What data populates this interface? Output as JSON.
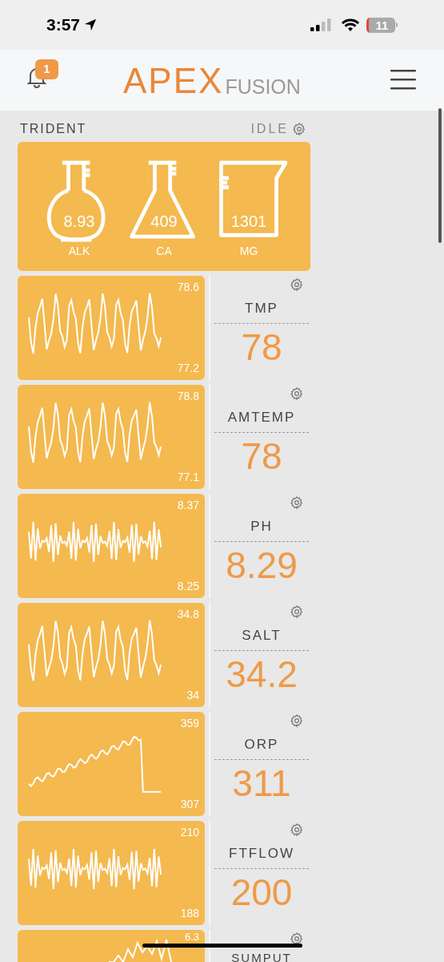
{
  "status_bar": {
    "time": "3:57",
    "battery": "11"
  },
  "header": {
    "notification_count": "1",
    "logo_main": "APEX",
    "logo_sub": "FUSION"
  },
  "trident": {
    "title": "TRIDENT",
    "status": "IDLE",
    "readings": [
      {
        "kind": "round_flask",
        "value": "8.93",
        "label": "ALK"
      },
      {
        "kind": "conical_flask",
        "value": "409",
        "label": "CA"
      },
      {
        "kind": "beaker",
        "value": "1301",
        "label": "MG"
      }
    ]
  },
  "probes": [
    {
      "name": "TMP",
      "value": "78",
      "max": "78.6",
      "min": "77.2"
    },
    {
      "name": "AMTEMP",
      "value": "78",
      "max": "78.8",
      "min": "77.1"
    },
    {
      "name": "PH",
      "value": "8.29",
      "max": "8.37",
      "min": "8.25"
    },
    {
      "name": "SALT",
      "value": "34.2",
      "max": "34.8",
      "min": "34"
    },
    {
      "name": "ORP",
      "value": "311",
      "max": "359",
      "min": "307"
    },
    {
      "name": "FTFLOW",
      "value": "200",
      "max": "210",
      "min": "188"
    },
    {
      "name": "SUMPUT",
      "max": "6.3"
    }
  ]
}
